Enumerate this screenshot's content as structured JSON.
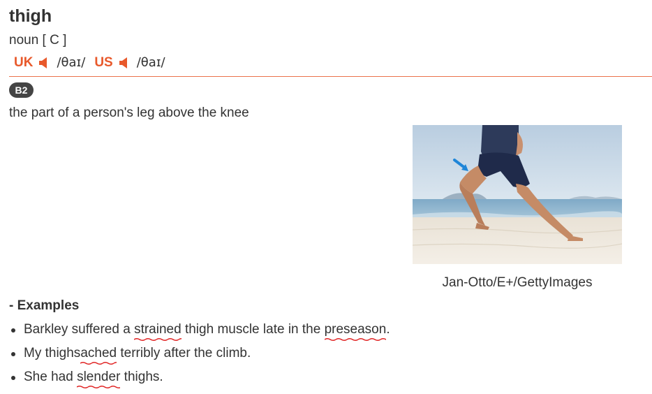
{
  "entry": {
    "headword": "thigh",
    "part_of_speech": "noun [ C ]",
    "pronunciations": [
      {
        "region": "UK",
        "ipa": "/θaɪ/",
        "icon": "speaker-icon"
      },
      {
        "region": "US",
        "ipa": "/θaɪ/",
        "icon": "speaker-icon"
      }
    ],
    "level": "B2",
    "definition": "the part of a person's leg above the knee",
    "image": {
      "credit": "Jan-Otto/E+/GettyImages"
    },
    "examples_heading": "- Examples",
    "examples": [
      {
        "parts": [
          {
            "text": "Barkley suffered a ",
            "flag": false
          },
          {
            "text": "strained",
            "flag": true
          },
          {
            "text": " thigh muscle late in the ",
            "flag": false
          },
          {
            "text": "preseason",
            "flag": true
          },
          {
            "text": ".",
            "flag": false
          }
        ]
      },
      {
        "parts": [
          {
            "text": "My thighs",
            "flag": false
          },
          {
            "text": " ached",
            "flag": true
          },
          {
            "text": " terribly after the climb.",
            "flag": false
          }
        ]
      },
      {
        "parts": [
          {
            "text": "She had ",
            "flag": false
          },
          {
            "text": "slender",
            "flag": true
          },
          {
            "text": " thighs.",
            "flag": false
          }
        ]
      }
    ]
  },
  "colors": {
    "accent": "#e8592b",
    "text": "#333333",
    "badge": "#444444",
    "spellcheck": "#e02020"
  }
}
